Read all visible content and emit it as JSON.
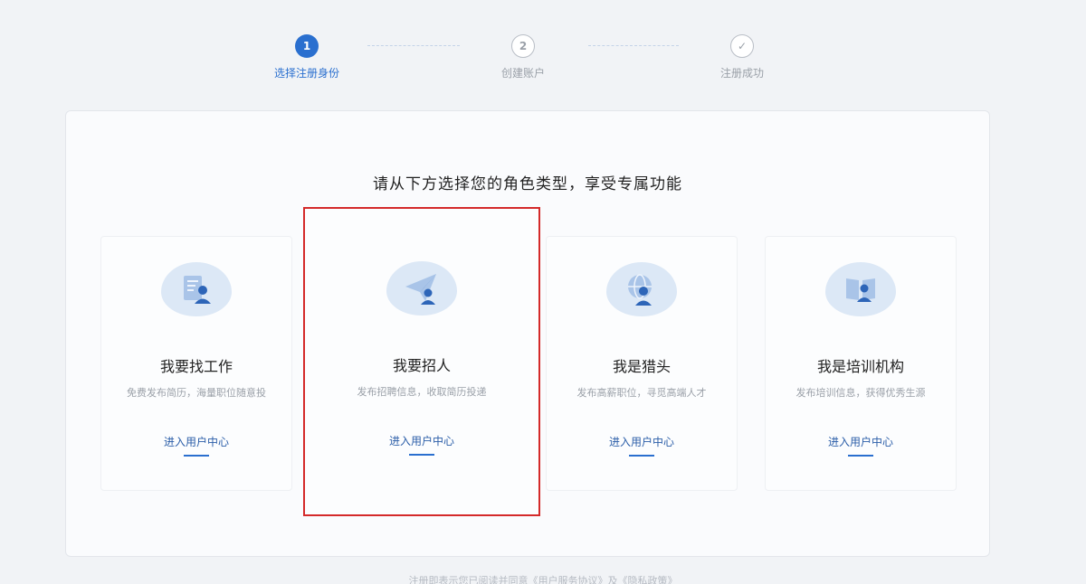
{
  "stepper": {
    "steps": [
      {
        "number": "1",
        "label": "选择注册身份"
      },
      {
        "number": "2",
        "label": "创建账户"
      },
      {
        "number": "✓",
        "label": "注册成功"
      }
    ]
  },
  "main": {
    "prompt": "请从下方选择您的角色类型，享受专属功能",
    "roles": [
      {
        "title": "我要找工作",
        "desc": "免费发布简历，海量职位随意投",
        "link": "进入用户中心"
      },
      {
        "title": "我要招人",
        "desc": "发布招聘信息，收取简历投递",
        "link": "进入用户中心"
      },
      {
        "title": "我是猎头",
        "desc": "发布高薪职位，寻觅高端人才",
        "link": "进入用户中心"
      },
      {
        "title": "我是培训机构",
        "desc": "发布培训信息，获得优秀生源",
        "link": "进入用户中心"
      }
    ]
  },
  "footer": {
    "text": "注册即表示您已阅读并同意《用户服务协议》及《隐私政策》"
  },
  "colors": {
    "accent": "#2a6fcf",
    "selection_border": "#d42a2a",
    "icon_bg": "#dce8f6",
    "page_bg": "#f1f3f6"
  },
  "icons": [
    "resume-person-icon",
    "paper-plane-person-icon",
    "globe-person-icon",
    "book-person-icon",
    "check-icon"
  ]
}
